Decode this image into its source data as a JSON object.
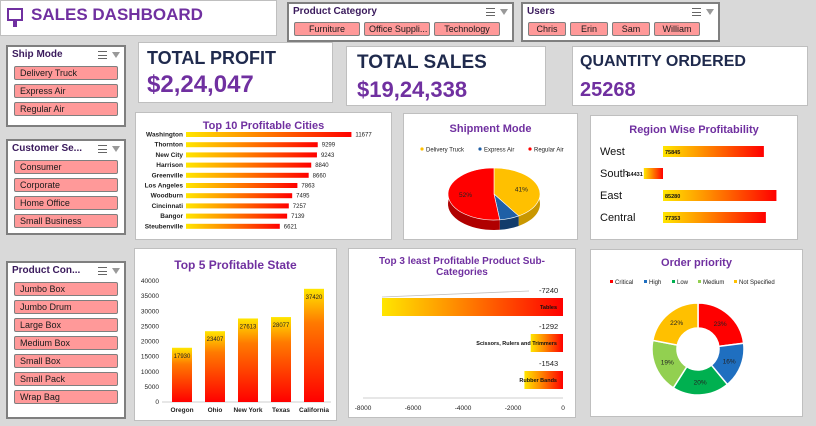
{
  "header": {
    "title": "SALES DASHBOARD"
  },
  "slicers": {
    "product_category": {
      "title": "Product Category",
      "items": [
        "Furniture",
        "Office Suppli...",
        "Technology"
      ]
    },
    "users": {
      "title": "Users",
      "items": [
        "Chris",
        "Erin",
        "Sam",
        "William"
      ]
    },
    "ship_mode": {
      "title": "Ship Mode",
      "items": [
        "Delivery Truck",
        "Express Air",
        "Regular Air"
      ]
    },
    "customer_segment": {
      "title": "Customer Se...",
      "items": [
        "Consumer",
        "Corporate",
        "Home Office",
        "Small Business"
      ]
    },
    "product_container": {
      "title": "Product Con...",
      "items": [
        "Jumbo Box",
        "Jumbo Drum",
        "Large Box",
        "Medium Box",
        "Small Box",
        "Small Pack",
        "Wrap Bag"
      ]
    }
  },
  "kpis": {
    "total_profit": {
      "label": "TOTAL PROFIT",
      "value": "$2,24,047"
    },
    "total_sales": {
      "label": "TOTAL SALES",
      "value": "$19,24,338"
    },
    "quantity": {
      "label": "QUANTITY ORDERED",
      "value": "25268"
    }
  },
  "colors": {
    "accent": "#7030a0",
    "slicer_item": "#ff9999",
    "bar_start": "#ffd700",
    "bar_end": "#ff0000"
  },
  "chart_data": [
    {
      "id": "top-cities",
      "type": "bar",
      "orientation": "horizontal",
      "title": "Top 10 Profitable Cities",
      "categories": [
        "Washington",
        "Thornton",
        "New City",
        "Harrison",
        "Greenville",
        "Los Angeles",
        "Woodburn",
        "Cincinnati",
        "Bangor",
        "Steubenville"
      ],
      "values": [
        11677,
        9299,
        9243,
        8840,
        8660,
        7863,
        7495,
        7257,
        7139,
        6621
      ],
      "xlim": [
        0,
        12000
      ]
    },
    {
      "id": "shipment-mode",
      "type": "pie",
      "title": "Shipment Mode",
      "labels": [
        "Delivery Truck",
        "Express Air",
        "Regular Air"
      ],
      "values": [
        41,
        7,
        52
      ],
      "display": [
        "41%",
        "",
        "52%"
      ],
      "colors": [
        "#ffc000",
        "#1f5fa6",
        "#ff0000"
      ],
      "legend": "top"
    },
    {
      "id": "region-profit",
      "type": "bar",
      "orientation": "horizontal",
      "title": "Region Wise Profitability",
      "categories": [
        "West",
        "South",
        "East",
        "Central"
      ],
      "values": [
        75845,
        -14431,
        85280,
        77353
      ],
      "xlim": [
        -20000,
        90000
      ]
    },
    {
      "id": "top-states",
      "type": "bar",
      "title": "Top 5 Profitable State",
      "categories": [
        "Oregon",
        "Ohio",
        "New York",
        "Texas",
        "California"
      ],
      "values": [
        17930,
        23407,
        27613,
        28077,
        37420
      ],
      "ylim": [
        0,
        40000
      ],
      "yticks": [
        "0",
        "5000",
        "10000",
        "15000",
        "20000",
        "25000",
        "30000",
        "35000",
        "40000"
      ]
    },
    {
      "id": "least-subcats",
      "type": "bar",
      "orientation": "horizontal",
      "title": [
        "Top 3 least Profitable Product Sub-",
        "Categories"
      ],
      "categories": [
        "Tables",
        "Scissors, Rulers and Trimmers",
        "Rubber Bands"
      ],
      "values": [
        -7240,
        -1292,
        -1543
      ],
      "labels": [
        "-7240",
        "-1292",
        "-1543"
      ],
      "xlim": [
        -8000,
        0
      ],
      "xticks": [
        "-8000",
        "-6000",
        "-4000",
        "-2000",
        "0"
      ]
    },
    {
      "id": "order-priority",
      "type": "pie",
      "donut": true,
      "title": "Order priority",
      "labels": [
        "Critical",
        "High",
        "Low",
        "Medium",
        "Not Specified"
      ],
      "values": [
        23,
        16,
        20,
        19,
        22
      ],
      "display": [
        "23%",
        "16%",
        "20%",
        "19%",
        "22%"
      ],
      "colors": [
        "#ff0000",
        "#1f6fc0",
        "#00b050",
        "#92d050",
        "#ffc000"
      ],
      "legend": "top"
    }
  ]
}
